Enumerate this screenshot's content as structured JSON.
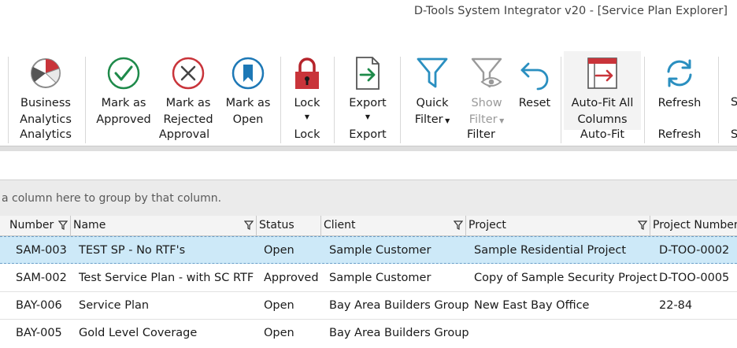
{
  "window": {
    "title": "D-Tools System Integrator v20 - [Service Plan Explorer]"
  },
  "ribbon": {
    "buttons": {
      "business_analytics": "Business\nAnalytics",
      "mark_approved": "Mark as\nApproved",
      "mark_rejected": "Mark as\nRejected",
      "mark_open": "Mark as\nOpen",
      "lock": "Lock",
      "export": "Export",
      "quick_filter": "Quick\nFilter",
      "show_filter": "Show\nFilter",
      "reset": "Reset",
      "autofit": "Auto-Fit All\nColumns",
      "refresh": "Refresh",
      "cut_label": "S",
      "cut_group": "S"
    },
    "groups": {
      "analytics": "Analytics",
      "approval": "Approval",
      "lock": "Lock",
      "export": "Export",
      "filter": "Filter",
      "autofit": "Auto-Fit",
      "refresh": "Refresh"
    },
    "colors": {
      "green": "#1e8a4a",
      "red": "#c9343a",
      "blue": "#1d78b6",
      "teal": "#2a8fc0",
      "grey": "#9a9a9a"
    }
  },
  "grid": {
    "group_hint": "a column here to group by that column.",
    "columns": [
      "Number",
      "Name",
      "Status",
      "Client",
      "Project",
      "Project Number"
    ],
    "rows": [
      [
        "SAM-003",
        "TEST SP - No RTF's",
        "Open",
        "Sample Customer",
        "Sample Residential Project",
        "D-TOO-0002"
      ],
      [
        "SAM-002",
        "Test Service Plan - with SC RTF",
        "Approved",
        "Sample Customer",
        "Copy of Sample Security Project",
        "D-TOO-0005"
      ],
      [
        "BAY-006",
        "Service Plan",
        "Open",
        "Bay Area Builders Group",
        "New East Bay Office",
        "22-84"
      ],
      [
        "BAY-005",
        "Gold Level Coverage",
        "Open",
        "Bay Area Builders Group",
        "",
        ""
      ]
    ],
    "selected_row": 0
  }
}
